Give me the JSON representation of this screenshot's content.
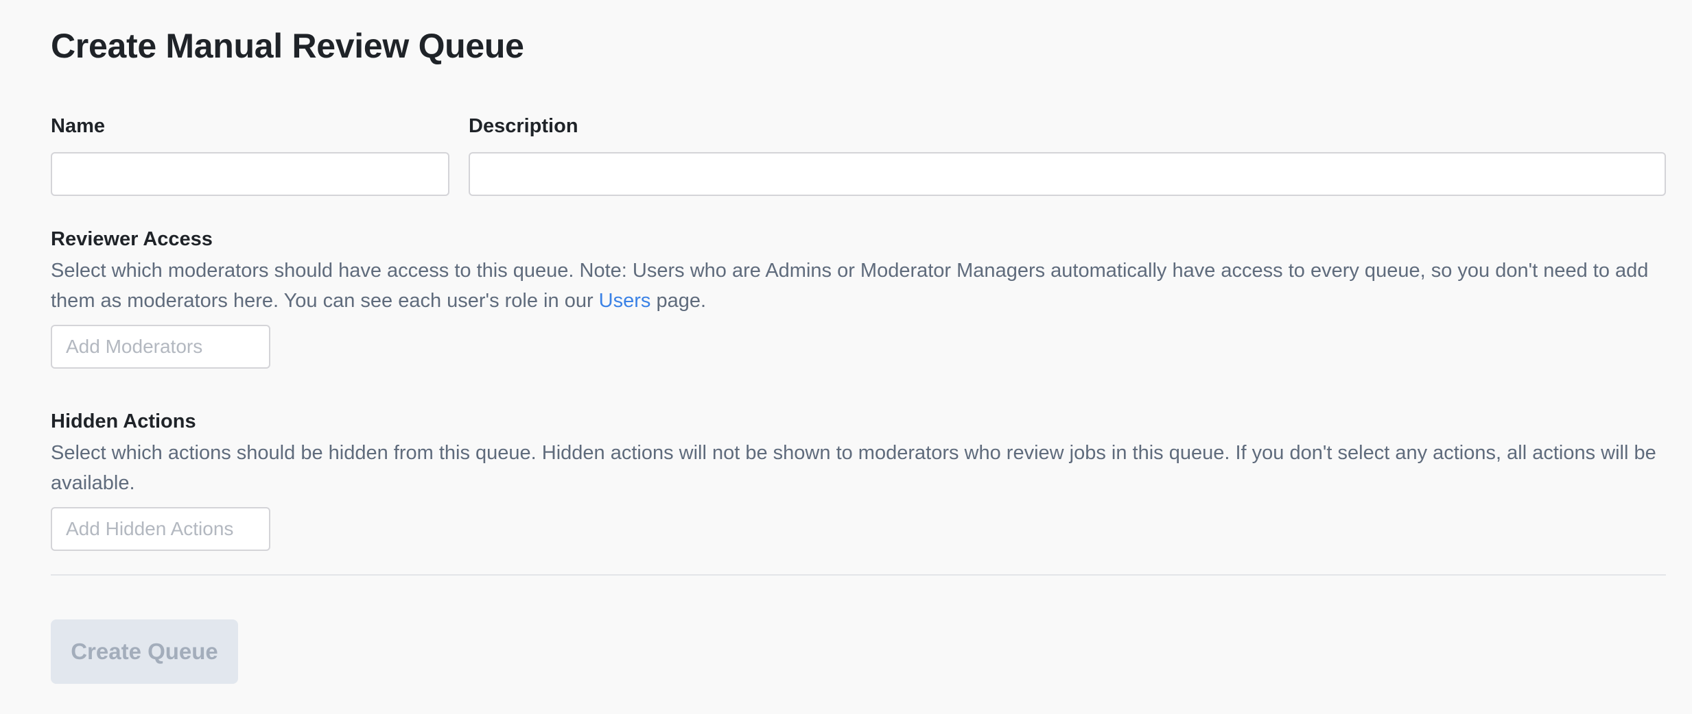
{
  "page": {
    "title": "Create Manual Review Queue"
  },
  "form": {
    "name": {
      "label": "Name",
      "value": "",
      "placeholder": ""
    },
    "description": {
      "label": "Description",
      "value": "",
      "placeholder": ""
    },
    "reviewer_access": {
      "heading": "Reviewer Access",
      "help_before_link": "Select which moderators should have access to this queue. Note: Users who are Admins or Moderator Managers automatically have access to every queue, so you don't need to add them as moderators here. You can see each user's role in our ",
      "help_link": "Users",
      "help_after_link": " page.",
      "placeholder": "Add Moderators"
    },
    "hidden_actions": {
      "heading": "Hidden Actions",
      "help": "Select which actions should be hidden from this queue. Hidden actions will not be shown to moderators who review jobs in this queue. If you don't select any actions, all actions will be available.",
      "placeholder": "Add Hidden Actions"
    },
    "submit": {
      "label": "Create Queue",
      "disabled": true
    }
  },
  "colors": {
    "background": "#f9f9f9",
    "text_primary": "#1f2328",
    "text_secondary": "#5f6b7c",
    "link": "#3b82e6",
    "placeholder": "#b3b8c0",
    "input_border": "#d4d4d8",
    "button_disabled_bg": "#e2e7ee",
    "button_disabled_text": "#a3adbb",
    "divider": "#e3e5e8"
  }
}
